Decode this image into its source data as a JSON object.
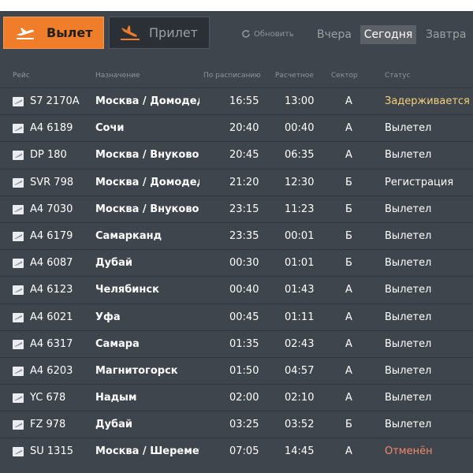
{
  "tabs": {
    "departure_label": "Вылет",
    "arrival_label": "Прилет"
  },
  "refresh_label": "Обновить",
  "days": {
    "yesterday": "Вчера",
    "today": "Сегодня",
    "tomorrow": "Завтра"
  },
  "columns": {
    "flight": "Рейс",
    "destination": "Назначение",
    "scheduled": "По расписанию",
    "estimated": "Расчетное",
    "sector": "Сектор",
    "status": "Статус"
  },
  "colors": {
    "accent": "#f07d2a",
    "board_bg": "#3f454d",
    "delayed": "#f3d27a",
    "cancelled": "#f08a6c"
  },
  "flights": [
    {
      "flight": "S7 2170A",
      "destination": "Москва / Домодедово",
      "scheduled": "16:55",
      "estimated": "13:00",
      "sector": "А",
      "status": "Задерживается",
      "status_type": "delayed"
    },
    {
      "flight": "A4 6189",
      "destination": "Сочи",
      "scheduled": "20:40",
      "estimated": "00:40",
      "sector": "А",
      "status": "Вылетел",
      "status_type": "normal"
    },
    {
      "flight": "DP 180",
      "destination": "Москва / Внуково",
      "scheduled": "20:45",
      "estimated": "06:35",
      "sector": "А",
      "status": "Вылетел",
      "status_type": "normal"
    },
    {
      "flight": "SVR 798",
      "destination": "Москва / Домодедово",
      "scheduled": "21:20",
      "estimated": "12:30",
      "sector": "Б",
      "status": "Регистрация",
      "status_type": "normal"
    },
    {
      "flight": "A4 7030",
      "destination": "Москва / Внуково",
      "scheduled": "23:15",
      "estimated": "11:23",
      "sector": "Б",
      "status": "Вылетел",
      "status_type": "normal"
    },
    {
      "flight": "A4 6179",
      "destination": "Самарканд",
      "scheduled": "23:35",
      "estimated": "00:01",
      "sector": "Б",
      "status": "Вылетел",
      "status_type": "normal"
    },
    {
      "flight": "A4 6087",
      "destination": "Дубай",
      "scheduled": "00:30",
      "estimated": "01:01",
      "sector": "Б",
      "status": "Вылетел",
      "status_type": "normal"
    },
    {
      "flight": "A4 6123",
      "destination": "Челябинск",
      "scheduled": "00:40",
      "estimated": "01:43",
      "sector": "А",
      "status": "Вылетел",
      "status_type": "normal"
    },
    {
      "flight": "A4 6021",
      "destination": "Уфа",
      "scheduled": "00:45",
      "estimated": "01:11",
      "sector": "А",
      "status": "Вылетел",
      "status_type": "normal"
    },
    {
      "flight": "A4 6317",
      "destination": "Самара",
      "scheduled": "01:35",
      "estimated": "02:43",
      "sector": "А",
      "status": "Вылетел",
      "status_type": "normal"
    },
    {
      "flight": "A4 6203",
      "destination": "Магнитогорск",
      "scheduled": "01:50",
      "estimated": "04:57",
      "sector": "А",
      "status": "Вылетел",
      "status_type": "normal"
    },
    {
      "flight": "YC 678",
      "destination": "Надым",
      "scheduled": "02:00",
      "estimated": "02:10",
      "sector": "А",
      "status": "Вылетел",
      "status_type": "normal"
    },
    {
      "flight": "FZ 978",
      "destination": "Дубай",
      "scheduled": "03:25",
      "estimated": "03:52",
      "sector": "Б",
      "status": "Вылетел",
      "status_type": "normal"
    },
    {
      "flight": "SU 1315",
      "destination": "Москва / Шереметьево",
      "scheduled": "07:05",
      "estimated": "14:45",
      "sector": "А",
      "status": "Отменён",
      "status_type": "cancelled"
    }
  ]
}
